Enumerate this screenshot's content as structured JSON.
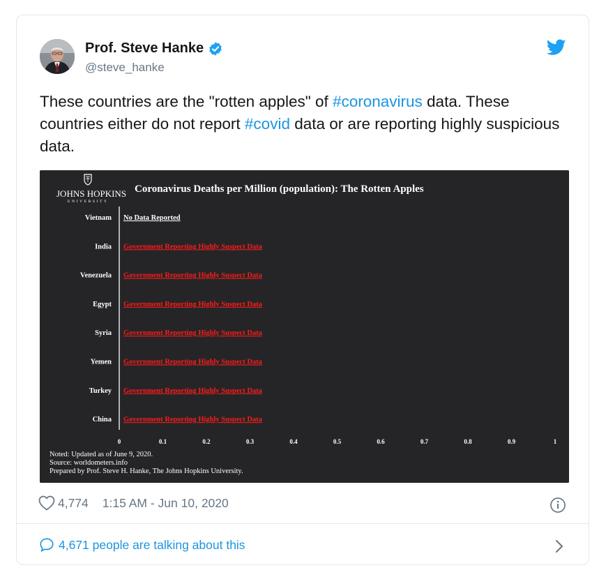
{
  "tweet": {
    "author": {
      "display_name": "Prof. Steve Hanke",
      "handle": "@steve_hanke",
      "verified": true,
      "avatar_icon": "portrait-avatar"
    },
    "text_parts": [
      {
        "text": "These countries are the \"rotten apples\" of ",
        "type": "plain"
      },
      {
        "text": "#coronavirus",
        "type": "hashtag"
      },
      {
        "text": " data. These countries either do not report ",
        "type": "plain"
      },
      {
        "text": "#covid",
        "type": "hashtag"
      },
      {
        "text": " data or are reporting highly suspicious data.",
        "type": "plain"
      }
    ],
    "likes": "4,774",
    "timestamp": "1:15 AM - Jun 10, 2020",
    "talking_text": "4,671 people are talking about this",
    "colors": {
      "link": "#1b95e0",
      "text": "#14171a",
      "muted": "#657786",
      "chart_bg": "#252527",
      "suspect": "#ff1a1a"
    }
  },
  "chart_data": {
    "type": "bar",
    "title": "Coronavirus Deaths per Million (population):  The Rotten Apples",
    "logo_text": "JOHNS HOPKINS",
    "logo_subtext": "UNIVERSITY",
    "categories": [
      "Vietnam",
      "India",
      "Venezuela",
      "Egypt",
      "Syria",
      "Yemen",
      "Turkey",
      "China"
    ],
    "values": [
      0,
      0,
      0,
      0,
      0,
      0,
      0,
      0
    ],
    "bar_labels": [
      "No Data Reported",
      "Government Reporting Highly Suspect Data",
      "Government Reporting Highly Suspect Data",
      "Government Reporting Highly Suspect Data",
      "Government Reporting Highly Suspect Data",
      "Government Reporting Highly Suspect Data",
      "Government Reporting Highly Suspect Data",
      "Government Reporting Highly Suspect Data"
    ],
    "label_colors": [
      "#ffffff",
      "#ff1a1a",
      "#ff1a1a",
      "#ff1a1a",
      "#ff1a1a",
      "#ff1a1a",
      "#ff1a1a",
      "#ff1a1a"
    ],
    "xticks": [
      "0",
      "0.1",
      "0.2",
      "0.3",
      "0.4",
      "0.5",
      "0.6",
      "0.7",
      "0.8",
      "0.9",
      "1"
    ],
    "xlim": [
      0,
      1
    ],
    "notes": [
      "Noted: Updated as of June 9, 2020.",
      "Source: worldometers.info",
      "Prepared by Prof. Steve H. Hanke, The Johns Hopkins University."
    ]
  }
}
